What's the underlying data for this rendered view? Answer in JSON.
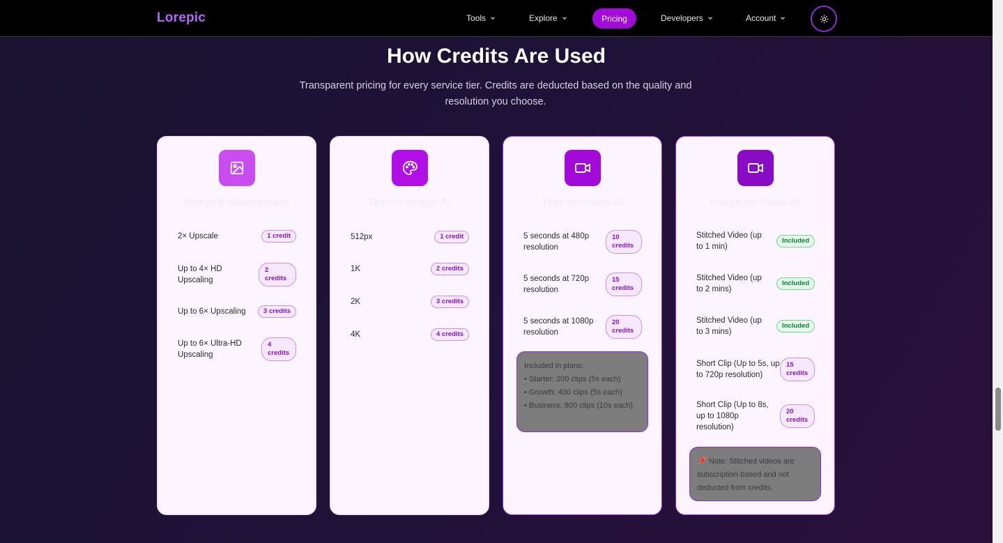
{
  "nav": {
    "logo": "Lorepic",
    "items": [
      "Tools",
      "Explore",
      "Pricing",
      "Developers",
      "Account"
    ]
  },
  "section": {
    "title": "How Credits Are Used",
    "subtitle": "Transparent pricing for every service tier. Credits are deducted based on the quality and resolution you choose."
  },
  "cards": [
    {
      "title": "Image Enhancement",
      "icon": "image-icon",
      "rows": [
        {
          "label": "2× Upscale",
          "badge": "1 credit"
        },
        {
          "label": "Up to 4× HD Upscaling",
          "badge": "2 credits"
        },
        {
          "label": "Up to 6× Upscaling",
          "badge": "3 credits"
        },
        {
          "label": "Up to 6× Ultra-HD Upscaling",
          "badge": "4 credits"
        }
      ]
    },
    {
      "title": "Text-to-Image AI",
      "icon": "palette-icon",
      "rows": [
        {
          "label": "512px",
          "badge": "1 credit"
        },
        {
          "label": "1K",
          "badge": "2 credits"
        },
        {
          "label": "2K",
          "badge": "3 credits"
        },
        {
          "label": "4K",
          "badge": "4 credits"
        }
      ]
    },
    {
      "title": "Text-to-Video AI",
      "icon": "video-icon",
      "rows": [
        {
          "label": "5 seconds at 480p resolution",
          "badge": "10 credits"
        },
        {
          "label": "5 seconds at 720p resolution",
          "badge": "15 credits"
        },
        {
          "label": "5 seconds at 1080p resolution",
          "badge": "20 credits"
        }
      ],
      "note": {
        "heading": "Included in plans:",
        "lines": [
          "• Starter: 200 clips (5s each)",
          "• Growth: 400 clips (5s each)",
          "• Business: 800 clips (10s each)"
        ]
      }
    },
    {
      "title": "Image-to-Video AI",
      "icon": "video-icon",
      "rows": [
        {
          "label": "Stitched Video (up to 1 min)",
          "badge": "Included"
        },
        {
          "label": "Stitched Video (up to 2 mins)",
          "badge": "Included"
        },
        {
          "label": "Stitched Video (up to 3 mins)",
          "badge": "Included"
        },
        {
          "label": "Short Clip (Up to 5s, up to 720p resolution)",
          "badge": "15 credits"
        },
        {
          "label": "Short Clip (Up to 8s, up to 1080p resolution)",
          "badge": "20 credits"
        }
      ],
      "note": {
        "text": "📌 Note: Stitched videos are subscription-based and not deducted from credits."
      }
    }
  ],
  "colors": {
    "accent": "#a30bd8",
    "logo": "#b266f5",
    "card_bg": "#fcf4ff",
    "included_green": "#137a3d"
  }
}
